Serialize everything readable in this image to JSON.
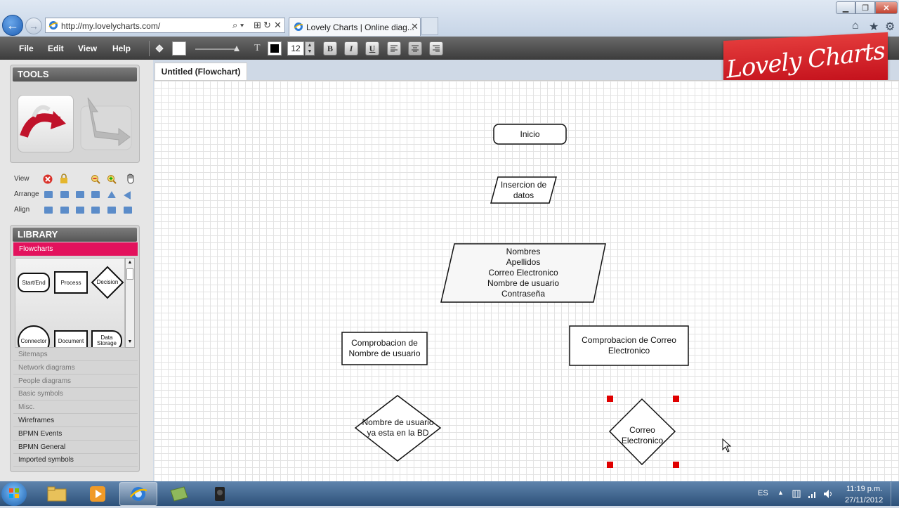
{
  "browser": {
    "url": "http://my.lovelycharts.com/",
    "tab_title": "Lovely Charts | Online diag...",
    "close_glyph": "✕",
    "search_glyph": "⌕ ▾",
    "compat_glyph": "⊞",
    "refresh_glyph": "↻",
    "stop_glyph": "✕",
    "min_glyph": "▁",
    "max_glyph": "❐",
    "win_close_glyph": "✕",
    "home_glyph": "⌂",
    "fav_glyph": "★",
    "tools_glyph": "⚙"
  },
  "menu": {
    "file": "File",
    "edit": "Edit",
    "view": "View",
    "help": "Help"
  },
  "format": {
    "font_size": "12",
    "bold": "B",
    "italic": "I",
    "underline": "U",
    "font_color": "#000000",
    "text_tool": "T"
  },
  "logo": {
    "text": "Lovely Charts"
  },
  "tools": {
    "title": "TOOLS",
    "rows": {
      "view": "View",
      "arrange": "Arrange",
      "align": "Align"
    }
  },
  "library": {
    "title": "LIBRARY",
    "selected": "Flowcharts",
    "shapes": [
      "Start/End",
      "Process",
      "Decision",
      "Connector",
      "Document",
      "Data Storage"
    ],
    "categories": [
      {
        "label": "Sitemaps",
        "dim": true
      },
      {
        "label": "Network diagrams",
        "dim": true
      },
      {
        "label": "People diagrams",
        "dim": true
      },
      {
        "label": "Basic symbols",
        "dim": true
      },
      {
        "label": "Misc.",
        "dim": true
      },
      {
        "label": "Wireframes",
        "dim": false
      },
      {
        "label": "BPMN Events",
        "dim": false
      },
      {
        "label": "BPMN General",
        "dim": false
      },
      {
        "label": "Imported symbols",
        "dim": false
      }
    ]
  },
  "document": {
    "tab_title": "Untitled (Flowchart)"
  },
  "diagram": {
    "inicio": "Inicio",
    "insercion": [
      "Insercion de",
      "datos"
    ],
    "datos": [
      "Nombres",
      "Apellidos",
      "Correo Electronico",
      "Nombre de usuario",
      "Contraseña"
    ],
    "comp_usuario": [
      "Comprobacion de",
      "Nombre de usuario"
    ],
    "comp_correo": [
      "Comprobacion de Correo",
      "Electronico"
    ],
    "dec_usuario": [
      "Nombre de usuario",
      "ya esta en la BD"
    ],
    "dec_correo": [
      "Correo",
      "Electronico"
    ]
  },
  "taskbar": {
    "lang": "ES",
    "time": "11:19 p.m.",
    "date": "27/11/2012"
  },
  "colors": {
    "accent": "#e3125d",
    "logo": "#d01a24",
    "handle": "#e00000"
  }
}
